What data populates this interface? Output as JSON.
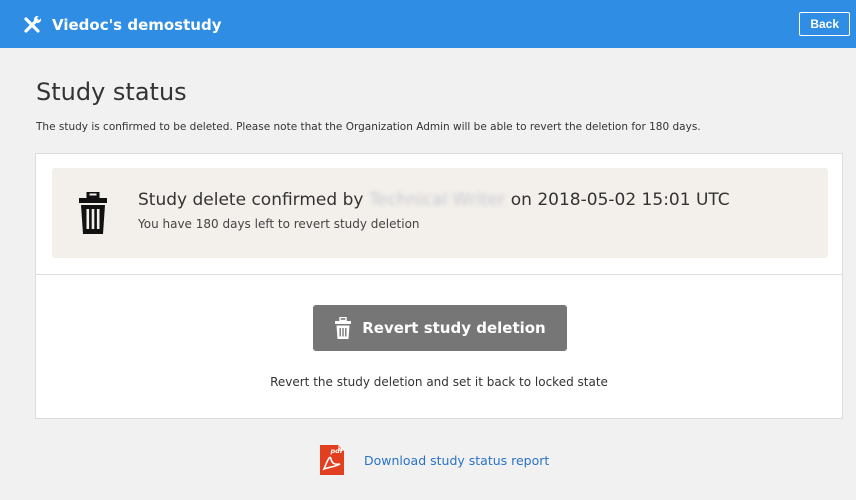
{
  "header": {
    "app_title": "Viedoc's demostudy",
    "logo_icon": "tools-icon",
    "back_label": "Back",
    "bar_color": "#2f8de4"
  },
  "page": {
    "title": "Study status",
    "description": "The study is confirmed to be deleted. Please note that the Organization Admin will be able to revert the deletion for 180 days."
  },
  "notice": {
    "icon": "trash-icon",
    "confirmed_prefix": "Study delete confirmed by",
    "confirmed_by": "Technical Writer",
    "confirmed_on": "on 2018-05-02 15:01 UTC",
    "days_left": "You have 180 days left to revert study deletion",
    "background": "#f3efeb"
  },
  "revert": {
    "icon": "trash-icon",
    "button_label": "Revert study deletion",
    "description": "Revert the study deletion and set it back to locked state",
    "button_color": "#767676"
  },
  "report": {
    "icon": "pdf-icon",
    "icon_text": "pdf",
    "link_label": "Download study status report",
    "link_color": "#2a73c9"
  }
}
